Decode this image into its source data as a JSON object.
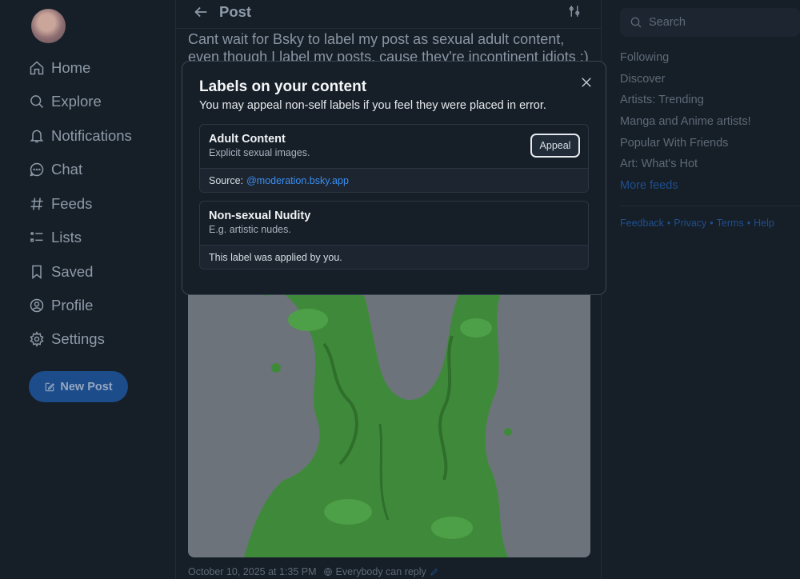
{
  "nav": {
    "items": [
      {
        "label": "Home",
        "icon": "home-icon"
      },
      {
        "label": "Explore",
        "icon": "search-icon"
      },
      {
        "label": "Notifications",
        "icon": "bell-icon"
      },
      {
        "label": "Chat",
        "icon": "chat-icon"
      },
      {
        "label": "Feeds",
        "icon": "hash-icon"
      },
      {
        "label": "Lists",
        "icon": "list-icon"
      },
      {
        "label": "Saved",
        "icon": "bookmark-icon"
      },
      {
        "label": "Profile",
        "icon": "user-circle-icon"
      },
      {
        "label": "Settings",
        "icon": "gear-icon"
      }
    ],
    "new_post_label": "New Post"
  },
  "header": {
    "title": "Post"
  },
  "post": {
    "text": "Cant wait for Bsky to label my post as sexual adult content, even though I label my posts, cause they're incontinent idiots :)",
    "timestamp": "October 10, 2025 at 1:35 PM",
    "reply_setting": "Everybody can reply"
  },
  "search": {
    "placeholder": "Search"
  },
  "feeds": {
    "items": [
      "Following",
      "Discover",
      "Artists: Trending",
      "Manga and Anime artists!",
      "Popular With Friends",
      "Art: What's Hot"
    ],
    "more_label": "More feeds"
  },
  "footer": {
    "feedback": "Feedback",
    "privacy": "Privacy",
    "terms": "Terms",
    "help": "Help"
  },
  "modal": {
    "title": "Labels on your content",
    "subtitle": "You may appeal non-self labels if you feel they were placed in error.",
    "labels": [
      {
        "name": "Adult Content",
        "description": "Explicit sexual images.",
        "source_prefix": "Source:",
        "source_link": "@moderation.bsky.app",
        "appeal_label": "Appeal"
      },
      {
        "name": "Non-sexual Nudity",
        "description": "E.g. artistic nudes.",
        "source_text": "This label was applied by you."
      }
    ]
  },
  "colors": {
    "background": "#161e27",
    "accent": "#1d4c8a",
    "link": "#3b8ff0",
    "image_slime": "#3f8a3a"
  }
}
